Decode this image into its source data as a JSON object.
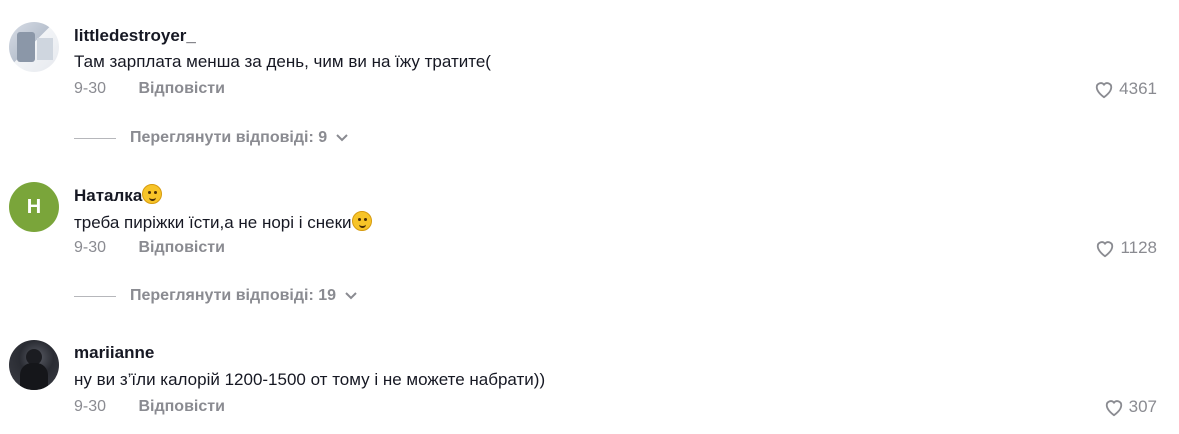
{
  "comments": [
    {
      "username": "littledestroyer_",
      "text": "Там зарплата менша за день, чим ви на їжу тратите(",
      "date": "9-30",
      "reply_label": "Відповісти",
      "likes": "4361",
      "view_replies": "Переглянути відповіді: 9"
    },
    {
      "avatar_letter": "H",
      "username": "Наталка",
      "text": "треба пиріжки їсти,а не норі і снеки",
      "date": "9-30",
      "reply_label": "Відповісти",
      "likes": "1128",
      "view_replies": "Переглянути відповіді: 19"
    },
    {
      "username": "mariianne",
      "text": "ну ви з’їли калорій 1200-1500 от тому і не можете набрати))",
      "date": "9-30",
      "reply_label": "Відповісти",
      "likes": "307"
    }
  ],
  "colors": {
    "avatar_green": "#7aa53a",
    "muted": "#8a8b91",
    "text": "#161823"
  },
  "icons": {
    "like": "heart-outline-icon",
    "expand": "chevron-down-icon",
    "emoji": "smile-emoji-icon"
  }
}
